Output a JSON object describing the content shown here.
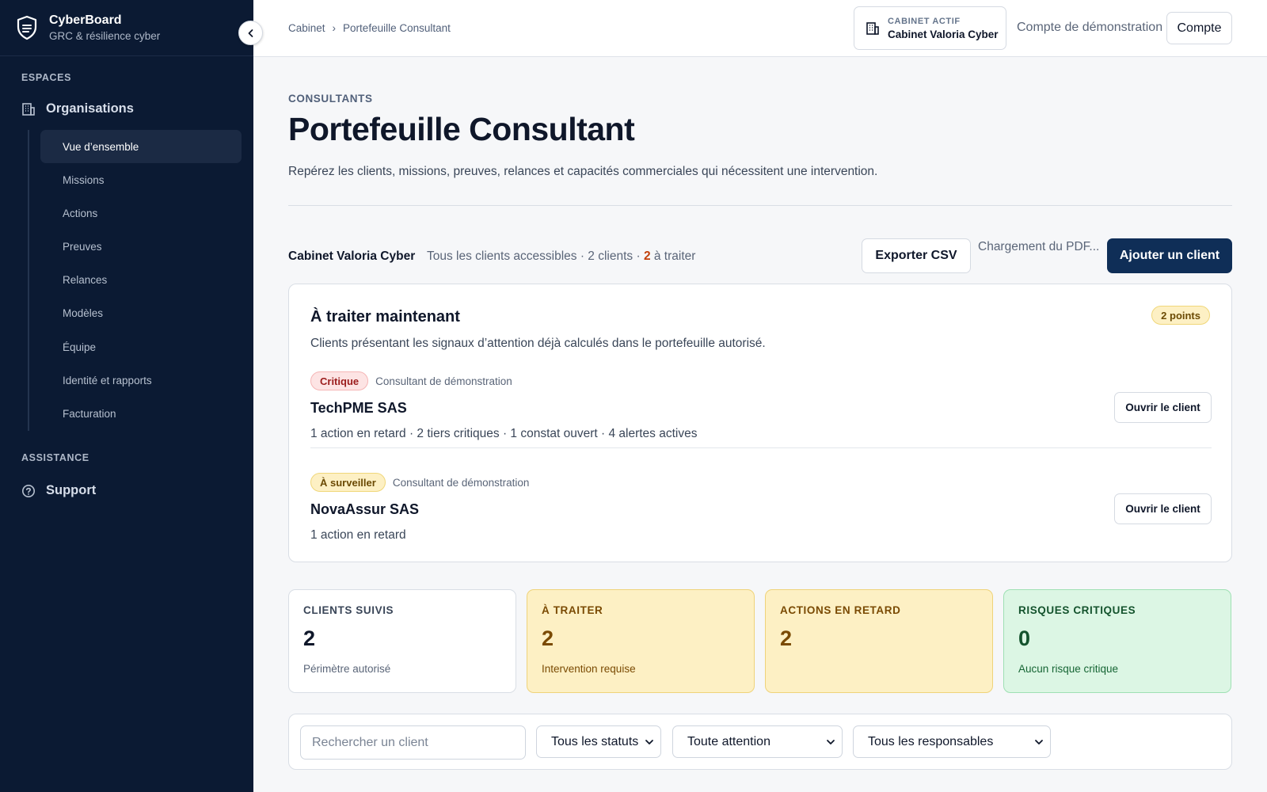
{
  "brand": {
    "name": "CyberBoard",
    "subtitle": "GRC & résilience cyber"
  },
  "sidebar": {
    "sections": [
      {
        "label": "ESPACES"
      },
      {
        "label": "ASSISTANCE"
      }
    ],
    "organisations_label": "Organisations",
    "items": [
      {
        "label": "Vue d’ensemble",
        "active": true
      },
      {
        "label": "Missions"
      },
      {
        "label": "Actions"
      },
      {
        "label": "Preuves"
      },
      {
        "label": "Relances"
      },
      {
        "label": "Modèles"
      },
      {
        "label": "Équipe"
      },
      {
        "label": "Identité et rapports"
      },
      {
        "label": "Facturation"
      }
    ],
    "support_label": "Support"
  },
  "topbar": {
    "breadcrumb": [
      "Cabinet",
      "Portefeuille Consultant"
    ],
    "breadcrumb_sep": "›",
    "active_cabinet_kicker": "CABINET ACTIF",
    "active_cabinet_name": "Cabinet Valoria Cyber",
    "demo_account": "Compte de démonstration",
    "account_button": "Compte"
  },
  "page": {
    "kicker": "CONSULTANTS",
    "title": "Portefeuille Consultant",
    "description": "Repérez les clients, missions, preuves, relances et capacités commerciales qui nécessitent une intervention."
  },
  "context": {
    "cabinet": "Cabinet Valoria Cyber",
    "scope": "Tous les clients accessibles · 2 clients · ",
    "todo_count": "2",
    "todo_suffix": " à traiter",
    "export_button": "Exporter CSV",
    "pdf_status": "Chargement du PDF...",
    "add_button": "Ajouter un client"
  },
  "attention": {
    "title": "À traiter maintenant",
    "points_badge": "2 points",
    "subtitle": "Clients présentant les signaux d’attention déjà calculés dans le portefeuille autorisé.",
    "clients": [
      {
        "badge": "Critique",
        "owner": "Consultant de démonstration",
        "name": "TechPME SAS",
        "meta": "1 action en retard · 2 tiers critiques · 1 constat ouvert · 4 alertes actives",
        "open_button": "Ouvrir le client"
      },
      {
        "badge": "À surveiller",
        "owner": "Consultant de démonstration",
        "name": "NovaAssur SAS",
        "meta": "1 action en retard",
        "open_button": "Ouvrir le client"
      }
    ]
  },
  "kpis": [
    {
      "label": "CLIENTS SUIVIS",
      "value": "2",
      "note": "Périmètre autorisé"
    },
    {
      "label": "À TRAITER",
      "value": "2",
      "note": "Intervention requise"
    },
    {
      "label": "ACTIONS EN RETARD",
      "value": "2",
      "note": ""
    },
    {
      "label": "RISQUES CRITIQUES",
      "value": "0",
      "note": "Aucun risque critique"
    }
  ],
  "filters": {
    "search_placeholder": "Rechercher un client",
    "status_selected": "Tous les statuts",
    "attention_selected": "Toute attention",
    "owner_selected": "Tous les responsables"
  },
  "colors": {
    "sidebar_bg": "#0b1a33",
    "primary": "#0f2e57",
    "critical": "#9b1c1c",
    "warning_bg": "#fdf0c4",
    "success_bg": "#dcf6e4",
    "todo_accent": "#c2410c"
  }
}
